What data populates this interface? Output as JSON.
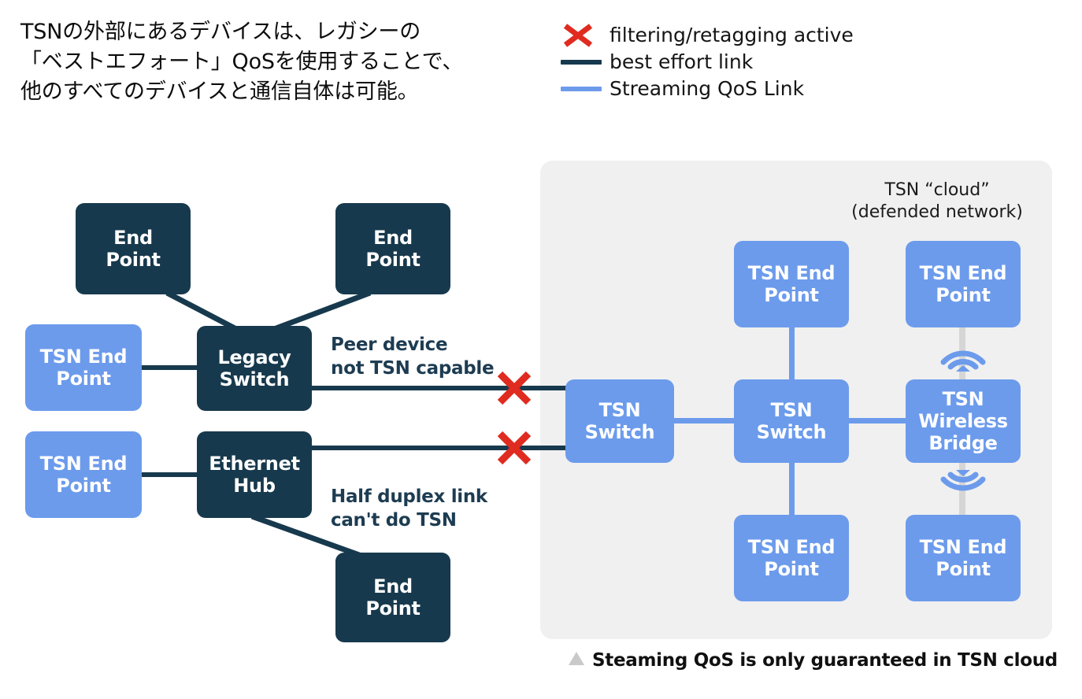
{
  "intro": {
    "text": "TSNの外部にあるデバイスは、レガシーの\n「ベストエフォート」QoSを使用することで、\n他のすべてのデバイスと通信自体は可能。"
  },
  "legend": {
    "items": [
      {
        "marker": "red-x-icon",
        "label": "filtering/retagging active",
        "color": "#e02b20"
      },
      {
        "marker": "line-icon",
        "label": "best effort link",
        "color": "#17394d"
      },
      {
        "marker": "line-icon",
        "label": "Streaming QoS Link",
        "color": "#6c9bec"
      }
    ]
  },
  "cloud": {
    "label_line1": "TSN “cloud”",
    "label_line2": "(defended network)",
    "fill": "#f0f0f0"
  },
  "nodes": {
    "end_point_top_left": "End\nPoint",
    "end_point_top_right": "End\nPoint",
    "tsn_end_point_left_upper": "TSN End\nPoint",
    "legacy_switch": "Legacy\nSwitch",
    "tsn_end_point_left_lower": "TSN End\nPoint",
    "ethernet_hub": "Ethernet\nHub",
    "end_point_bottom": "End\nPoint",
    "tsn_switch_left": "TSN\nSwitch",
    "tsn_end_point_cloud_top_mid": "TSN End\nPoint",
    "tsn_switch_mid": "TSN\nSwitch",
    "tsn_end_point_cloud_bottom_mid": "TSN End\nPoint",
    "tsn_end_point_cloud_top_right": "TSN End\nPoint",
    "tsn_wireless_bridge": "TSN\nWireless\nBridge",
    "tsn_end_point_cloud_bottom_right": "TSN End\nPoint"
  },
  "notes": {
    "peer_device": "Peer device\nnot TSN capable",
    "half_duplex": "Half duplex link\ncan't do TSN"
  },
  "footnote": {
    "marker": "triangle-icon",
    "text": "Steaming QoS is only guaranteed in TSN cloud"
  },
  "colors": {
    "dark_node": "#17394d",
    "blue_node": "#6c9bec",
    "red_x": "#e02b20",
    "cloud_bg": "#f0f0f0",
    "gray_wireless_line": "#d6d6d6"
  }
}
